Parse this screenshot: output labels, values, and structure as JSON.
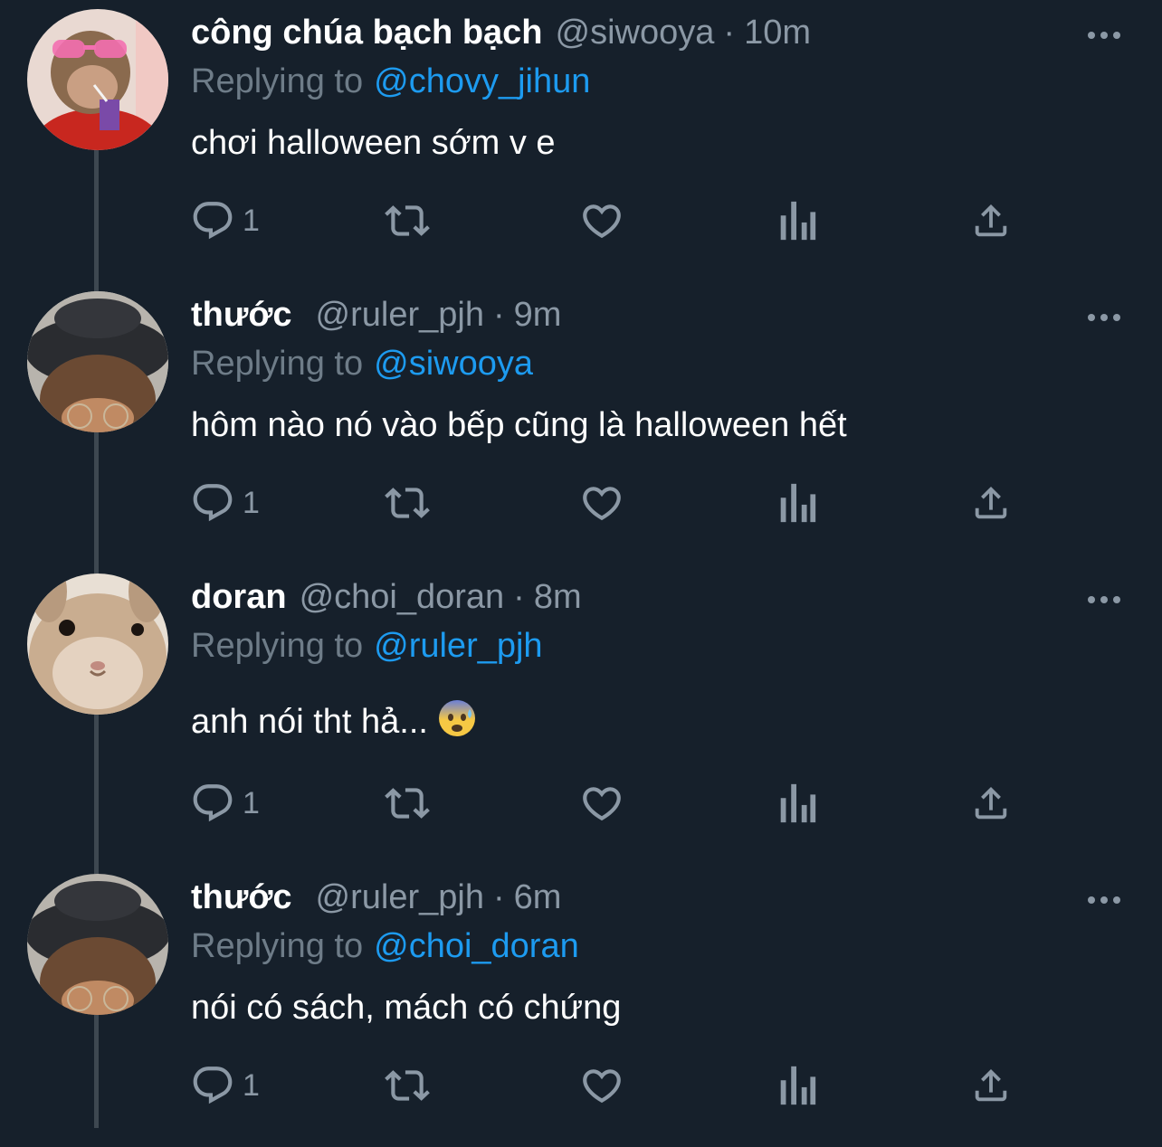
{
  "tweets": [
    {
      "display_name": "công chúa bạch bạch",
      "handle": "@siwooya",
      "separator": "·",
      "time": "10m",
      "replying_prefix": "Replying to",
      "replying_to": "@chovy_jihun",
      "text": "chơi halloween sớm v e",
      "reply_count": "1",
      "avatar": "monkey-avatar"
    },
    {
      "display_name": "thước",
      "handle": "@ruler_pjh",
      "separator": "·",
      "time": "9m",
      "replying_prefix": "Replying to",
      "replying_to": "@siwooya",
      "text": "hôm nào nó vào bếp cũng là halloween hết",
      "reply_count": "1",
      "avatar": "person-hat-avatar"
    },
    {
      "display_name": "doran",
      "handle": "@choi_doran",
      "separator": "·",
      "time": "8m",
      "replying_prefix": "Replying to",
      "replying_to": "@ruler_pjh",
      "text": "anh nói tht hả...",
      "emoji": "anxious-face-with-sweat-emoji",
      "reply_count": "1",
      "avatar": "rabbit-avatar"
    },
    {
      "display_name": "thước",
      "handle": "@ruler_pjh",
      "separator": "·",
      "time": "6m",
      "replying_prefix": "Replying to",
      "replying_to": "@choi_doran",
      "text": "nói có sách, mách có chứng",
      "reply_count": "1",
      "avatar": "person-hat-avatar"
    }
  ],
  "icons": {
    "reply": "reply-icon",
    "retweet": "retweet-icon",
    "like": "heart-icon",
    "analytics": "analytics-icon",
    "share": "share-icon",
    "more": "more-options-icon"
  },
  "colors": {
    "background": "#16202b",
    "text": "#ffffff",
    "secondary": "#8b98a5",
    "link": "#1d9bf0",
    "thread_line": "#3e4851"
  }
}
